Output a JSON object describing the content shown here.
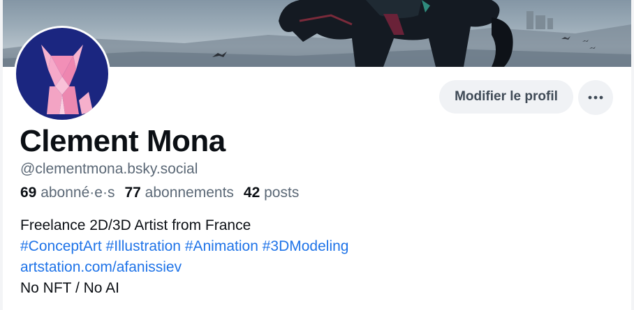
{
  "profile": {
    "name": "Clement Mona",
    "handle": "@clementmona.bsky.social",
    "stats": {
      "followers_count": "69",
      "followers_label": "abonné·e·s",
      "following_count": "77",
      "following_label": "abonnements",
      "posts_count": "42",
      "posts_label": "posts"
    },
    "bio": {
      "line1": "Freelance 2D/3D Artist from France",
      "hashtags": [
        "#ConceptArt",
        "#Illustration",
        "#Animation",
        "#3DModeling"
      ],
      "link": "artstation.com/afanissiev",
      "line4": "No NFT / No AI"
    }
  },
  "actions": {
    "edit_profile_label": "Modifier le profil",
    "more_icon": "ellipsis-icon"
  },
  "colors": {
    "link": "#1e73e8",
    "button_bg": "#f0f2f5",
    "muted_text": "#5b6876",
    "avatar_bg": "#1b2680",
    "avatar_figure": "#f3a4c4"
  }
}
